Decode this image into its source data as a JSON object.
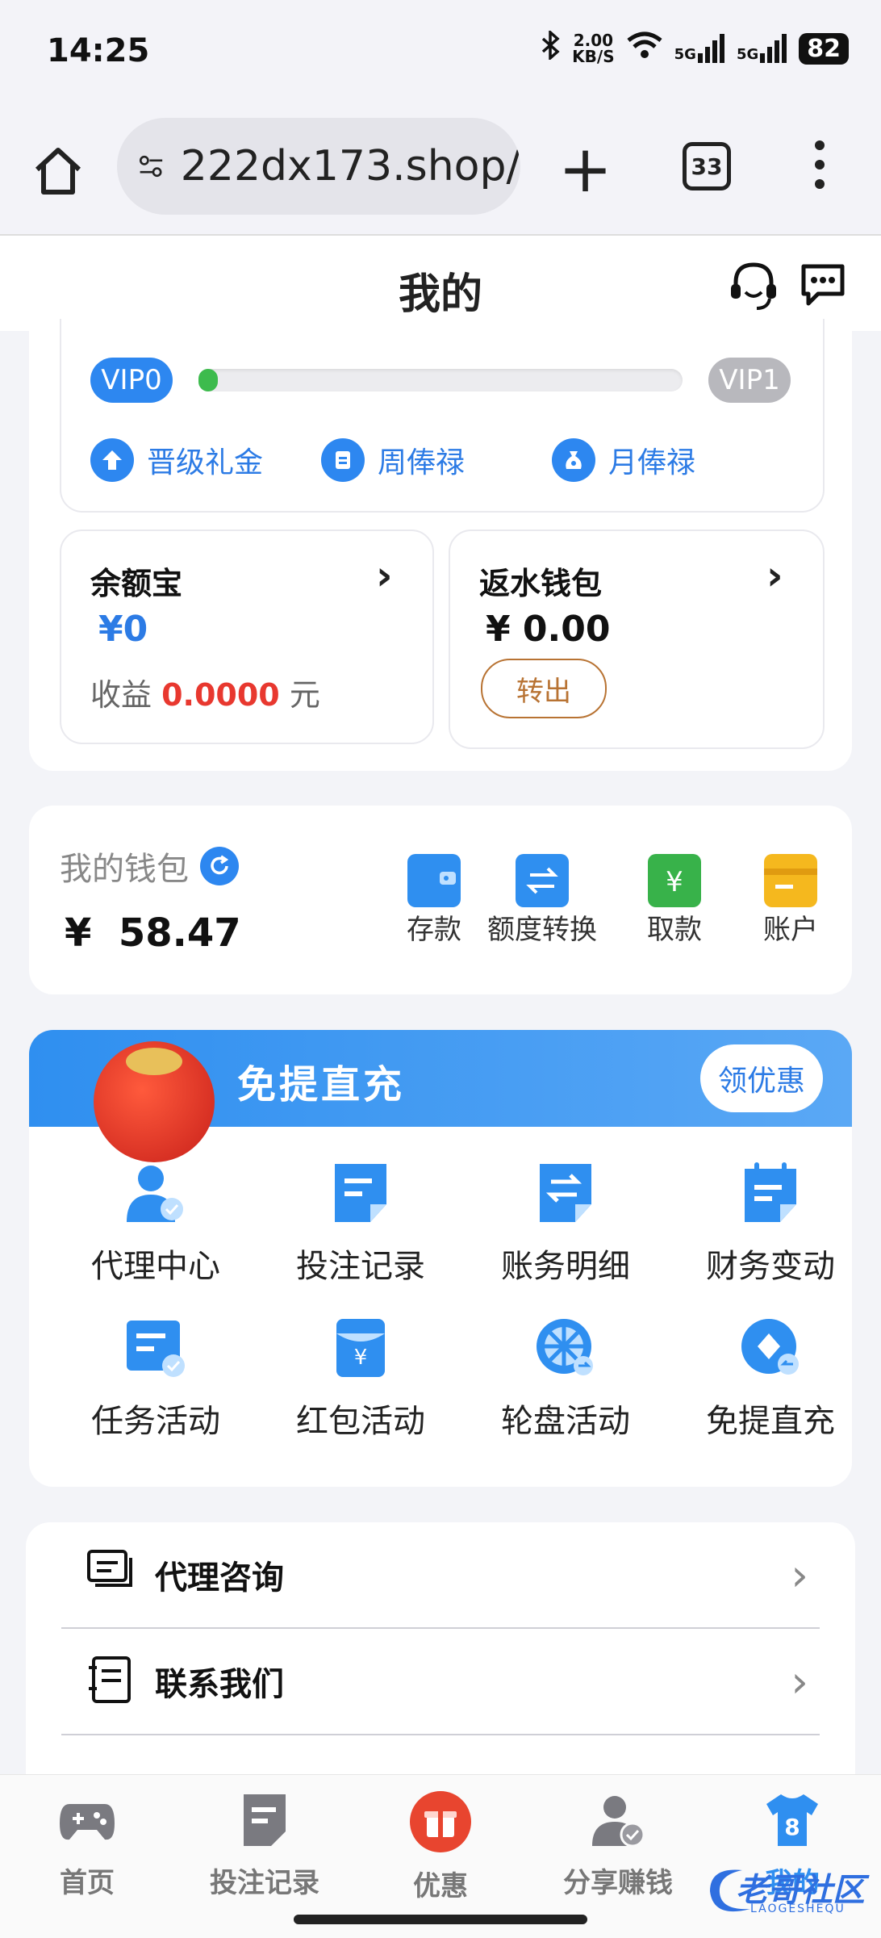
{
  "status_bar": {
    "time": "14:25",
    "net_speed": "2.00",
    "net_unit": "KB/S",
    "signal1": "5G",
    "signal2": "5G",
    "battery": "82"
  },
  "browser": {
    "url": "222dx173.shop/",
    "tab_count": "33"
  },
  "header": {
    "title": "我的"
  },
  "vip": {
    "current": "VIP0",
    "next": "VIP1",
    "progress": 0.04,
    "links": [
      {
        "label": "晋级礼金",
        "icon": "upgrade-icon"
      },
      {
        "label": "周俸禄",
        "icon": "weekly-icon"
      },
      {
        "label": "月俸禄",
        "icon": "monthly-icon"
      }
    ]
  },
  "yuebao": {
    "title": "余额宝",
    "amount": "¥0",
    "income_prefix": "收益",
    "income_value": "0.0000",
    "income_unit": "元"
  },
  "rebate": {
    "title": "返水钱包",
    "amount": "¥ 0.00",
    "transfer_label": "转出"
  },
  "wallet": {
    "title": "我的钱包",
    "amount": "¥  58.47",
    "actions": [
      {
        "label": "存款",
        "color": "#2f8ff0"
      },
      {
        "label": "额度转换",
        "color": "#2f8ff0"
      },
      {
        "label": "取款",
        "color": "#38b24a"
      },
      {
        "label": "账户",
        "color": "#f5b81e"
      }
    ]
  },
  "promo": {
    "title": "免提直充",
    "button": "领优惠"
  },
  "grid": [
    {
      "label": "代理中心",
      "icon": "agent-center-icon"
    },
    {
      "label": "投注记录",
      "icon": "bet-record-icon"
    },
    {
      "label": "账务明细",
      "icon": "account-detail-icon"
    },
    {
      "label": "财务变动",
      "icon": "finance-change-icon"
    },
    {
      "label": "任务活动",
      "icon": "task-icon"
    },
    {
      "label": "红包活动",
      "icon": "red-envelope-icon"
    },
    {
      "label": "轮盘活动",
      "icon": "roulette-icon"
    },
    {
      "label": "免提直充",
      "icon": "direct-recharge-icon"
    }
  ],
  "list": [
    {
      "label": "代理咨询"
    },
    {
      "label": "联系我们"
    }
  ],
  "nav": [
    {
      "label": "首页",
      "icon": "gamepad-icon"
    },
    {
      "label": "投注记录",
      "icon": "bet-record-icon"
    },
    {
      "label": "优惠",
      "icon": "gift-icon"
    },
    {
      "label": "分享赚钱",
      "icon": "share-user-icon"
    },
    {
      "label": "我的",
      "icon": "jersey-icon",
      "badge": "8",
      "active": true
    }
  ],
  "watermark": {
    "text": "老哥社区",
    "sub": "LAOGESHEQU"
  },
  "colors": {
    "accent": "#2c7be5",
    "promo_bg": "#3f95f0",
    "income_red": "#e8382f",
    "transfer_border": "#b87333"
  }
}
